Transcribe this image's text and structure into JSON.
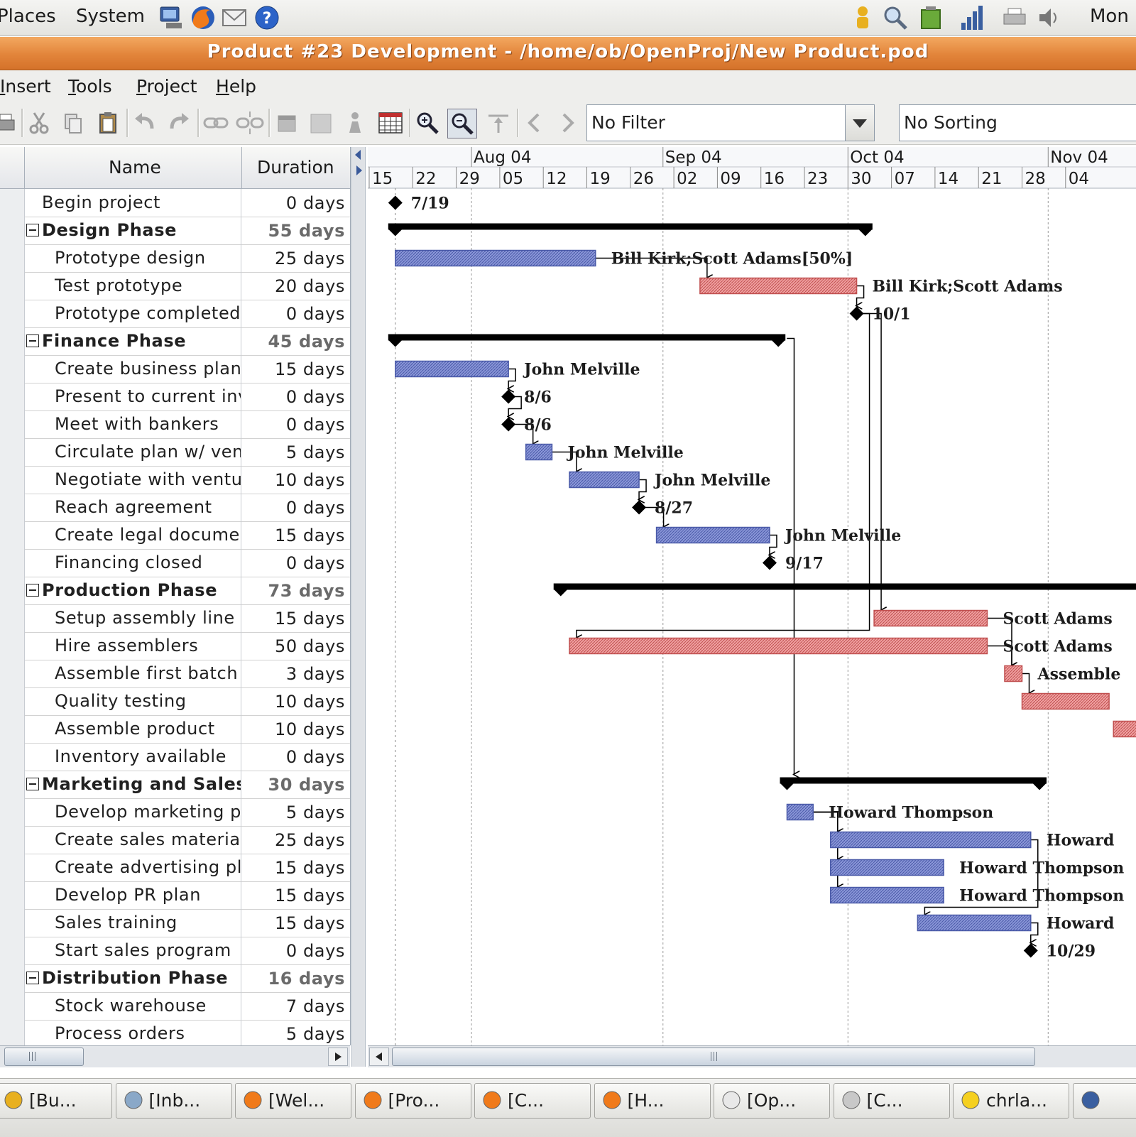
{
  "top_panel": {
    "menus": [
      "Places",
      "System"
    ],
    "launchers": [
      "network-icon",
      "firefox-icon",
      "mail-icon",
      "help-icon"
    ],
    "tray_icons": [
      "user-icon",
      "search-icon",
      "battery-icon",
      "signal-icon",
      "printer-icon",
      "volume-icon"
    ],
    "clock": "Mon"
  },
  "window": {
    "title": "Product #23 Development - /home/ob/OpenProj/New Product.pod"
  },
  "menu_bar": {
    "items": [
      {
        "mnemonic": "I",
        "rest": "nsert"
      },
      {
        "mnemonic": "T",
        "rest": "ools"
      },
      {
        "mnemonic": "P",
        "rest": "roject"
      },
      {
        "mnemonic": "H",
        "rest": "elp"
      }
    ]
  },
  "toolbar": {
    "buttons": [
      "print-icon",
      "cut-icon",
      "copy-icon",
      "paste-icon",
      "undo-icon",
      "redo-icon",
      "link-icon",
      "unlink-icon",
      "notes-icon",
      "info-icon",
      "resource-icon",
      "calendar-grid-icon",
      "zoom-in-icon",
      "zoom-out-icon",
      "scroll-to-task-icon",
      "previous-icon",
      "next-icon"
    ],
    "filter_value": "No Filter",
    "sorting_value": "No Sorting"
  },
  "table": {
    "columns": [
      "Name",
      "Duration"
    ],
    "rows": [
      {
        "name": "Begin project",
        "duration": "0 days",
        "summary": false
      },
      {
        "name": "Design Phase",
        "duration": "55 days",
        "summary": true
      },
      {
        "name": "Prototype design",
        "duration": "25 days",
        "summary": false
      },
      {
        "name": "Test prototype",
        "duration": "20 days",
        "summary": false
      },
      {
        "name": "Prototype completed",
        "duration": "0 days",
        "summary": false
      },
      {
        "name": "Finance Phase",
        "duration": "45 days",
        "summary": true
      },
      {
        "name": "Create business plan",
        "duration": "15 days",
        "summary": false
      },
      {
        "name": "Present to current investors",
        "duration": "0 days",
        "summary": false
      },
      {
        "name": "Meet with bankers",
        "duration": "0 days",
        "summary": false
      },
      {
        "name": "Circulate plan w/ venture capitalists",
        "duration": "5 days",
        "summary": false
      },
      {
        "name": "Negotiate with venture capitalists",
        "duration": "10 days",
        "summary": false
      },
      {
        "name": "Reach agreement",
        "duration": "0 days",
        "summary": false
      },
      {
        "name": "Create legal documentation",
        "duration": "15 days",
        "summary": false
      },
      {
        "name": "Financing closed",
        "duration": "0 days",
        "summary": false
      },
      {
        "name": "Production Phase",
        "duration": "73 days",
        "summary": true
      },
      {
        "name": "Setup assembly line",
        "duration": "15 days",
        "summary": false
      },
      {
        "name": "Hire assemblers",
        "duration": "50 days",
        "summary": false
      },
      {
        "name": "Assemble first batch",
        "duration": "3 days",
        "summary": false
      },
      {
        "name": "Quality testing",
        "duration": "10 days",
        "summary": false
      },
      {
        "name": "Assemble product",
        "duration": "10 days",
        "summary": false
      },
      {
        "name": "Inventory available",
        "duration": "0 days",
        "summary": false
      },
      {
        "name": "Marketing and Sales Phase",
        "duration": "30 days",
        "summary": true
      },
      {
        "name": "Develop marketing plan",
        "duration": "5 days",
        "summary": false
      },
      {
        "name": "Create sales materials",
        "duration": "25 days",
        "summary": false
      },
      {
        "name": "Create advertising plan",
        "duration": "15 days",
        "summary": false
      },
      {
        "name": "Develop PR plan",
        "duration": "15 days",
        "summary": false
      },
      {
        "name": "Sales training",
        "duration": "15 days",
        "summary": false
      },
      {
        "name": "Start sales program",
        "duration": "0 days",
        "summary": false
      },
      {
        "name": "Distribution Phase",
        "duration": "16 days",
        "summary": true
      },
      {
        "name": "Stock warehouse",
        "duration": "7 days",
        "summary": false
      },
      {
        "name": "Process orders",
        "duration": "5 days",
        "summary": false
      }
    ]
  },
  "gantt": {
    "months": [
      "Aug 04",
      "Sep 04",
      "Oct 04",
      "Nov 04"
    ],
    "weeks": [
      "15",
      "22",
      "29",
      "05",
      "12",
      "19",
      "26",
      "02",
      "09",
      "16",
      "23",
      "30",
      "07",
      "14",
      "21",
      "28",
      "04"
    ],
    "colors": {
      "normal_bar": "#4a5aa8",
      "normal_fill": "#8a96d8",
      "critical_bar": "#c05050",
      "critical_fill": "#f0a0a0",
      "summary": "#000000"
    },
    "tasks": [
      {
        "row": 0,
        "type": "milestone",
        "start": 0.6,
        "label": "7/19"
      },
      {
        "row": 1,
        "type": "summary",
        "start": 0.6,
        "end": 11.4
      },
      {
        "row": 2,
        "type": "task",
        "start": 0.6,
        "end": 5.2,
        "critical": false,
        "label": "Bill Kirk;Scott Adams[50%]"
      },
      {
        "row": 3,
        "type": "task",
        "start": 7.6,
        "end": 11.2,
        "critical": true,
        "label": "Bill Kirk;Scott Adams"
      },
      {
        "row": 4,
        "type": "milestone",
        "start": 11.2,
        "label": "10/1"
      },
      {
        "row": 5,
        "type": "summary",
        "start": 0.6,
        "end": 9.4
      },
      {
        "row": 6,
        "type": "task",
        "start": 0.6,
        "end": 3.2,
        "critical": false,
        "label": "John Melville"
      },
      {
        "row": 7,
        "type": "milestone",
        "start": 3.2,
        "label": "8/6"
      },
      {
        "row": 8,
        "type": "milestone",
        "start": 3.2,
        "label": "8/6"
      },
      {
        "row": 9,
        "type": "task",
        "start": 3.6,
        "end": 4.2,
        "critical": false,
        "label": "John Melville"
      },
      {
        "row": 10,
        "type": "task",
        "start": 4.6,
        "end": 6.2,
        "critical": false,
        "label": "John Melville"
      },
      {
        "row": 11,
        "type": "milestone",
        "start": 6.2,
        "label": "8/27"
      },
      {
        "row": 12,
        "type": "task",
        "start": 6.6,
        "end": 9.2,
        "critical": false,
        "label": "John Melville"
      },
      {
        "row": 13,
        "type": "milestone",
        "start": 9.2,
        "label": "9/17"
      },
      {
        "row": 14,
        "type": "summary",
        "start": 4.4,
        "end": 19.0
      },
      {
        "row": 15,
        "type": "task",
        "start": 11.6,
        "end": 14.2,
        "critical": true,
        "label": "Scott Adams"
      },
      {
        "row": 16,
        "type": "task",
        "start": 4.6,
        "end": 14.2,
        "critical": true,
        "label": "Scott Adams"
      },
      {
        "row": 17,
        "type": "task",
        "start": 14.6,
        "end": 15.0,
        "critical": true,
        "label": "Assemble"
      },
      {
        "row": 18,
        "type": "task",
        "start": 15.0,
        "end": 17.0,
        "critical": true,
        "label": ""
      },
      {
        "row": 19,
        "type": "task",
        "start": 17.1,
        "end": 18.5,
        "critical": true,
        "label": ""
      },
      {
        "row": 21,
        "type": "summary",
        "start": 9.6,
        "end": 15.4
      },
      {
        "row": 22,
        "type": "task",
        "start": 9.6,
        "end": 10.2,
        "critical": false,
        "label": "Howard Thompson"
      },
      {
        "row": 23,
        "type": "task",
        "start": 10.6,
        "end": 15.2,
        "critical": false,
        "label": "Howard"
      },
      {
        "row": 24,
        "type": "task",
        "start": 10.6,
        "end": 13.2,
        "critical": false,
        "label": "Howard Thompson"
      },
      {
        "row": 25,
        "type": "task",
        "start": 10.6,
        "end": 13.2,
        "critical": false,
        "label": "Howard Thompson"
      },
      {
        "row": 26,
        "type": "task",
        "start": 12.6,
        "end": 15.2,
        "critical": false,
        "label": "Howard"
      },
      {
        "row": 27,
        "type": "milestone",
        "start": 15.2,
        "label": "10/29"
      }
    ],
    "links": [
      [
        2,
        3
      ],
      [
        3,
        4
      ],
      [
        4,
        15
      ],
      [
        4,
        16
      ],
      [
        6,
        7
      ],
      [
        7,
        8
      ],
      [
        8,
        9
      ],
      [
        9,
        10
      ],
      [
        10,
        11
      ],
      [
        11,
        12
      ],
      [
        12,
        13
      ],
      [
        5,
        21
      ],
      [
        15,
        17
      ],
      [
        16,
        17
      ],
      [
        17,
        18
      ],
      [
        22,
        23
      ],
      [
        22,
        24
      ],
      [
        22,
        25
      ],
      [
        23,
        26
      ],
      [
        26,
        27
      ]
    ]
  },
  "taskbar": {
    "buttons": [
      {
        "icon": "user-icon",
        "label": "[Bu..."
      },
      {
        "icon": "mail-client-icon",
        "label": "[Inb..."
      },
      {
        "icon": "firefox-icon",
        "label": "[Wel..."
      },
      {
        "icon": "firefox-icon",
        "label": "[Pro..."
      },
      {
        "icon": "firefox-icon",
        "label": "[C..."
      },
      {
        "icon": "firefox-icon",
        "label": "[H..."
      },
      {
        "icon": "document-icon",
        "label": "[Op..."
      },
      {
        "icon": "editor-icon",
        "label": "[C..."
      },
      {
        "icon": "chat-icon",
        "label": "chrla..."
      },
      {
        "icon": "window-icon",
        "label": ""
      }
    ]
  }
}
